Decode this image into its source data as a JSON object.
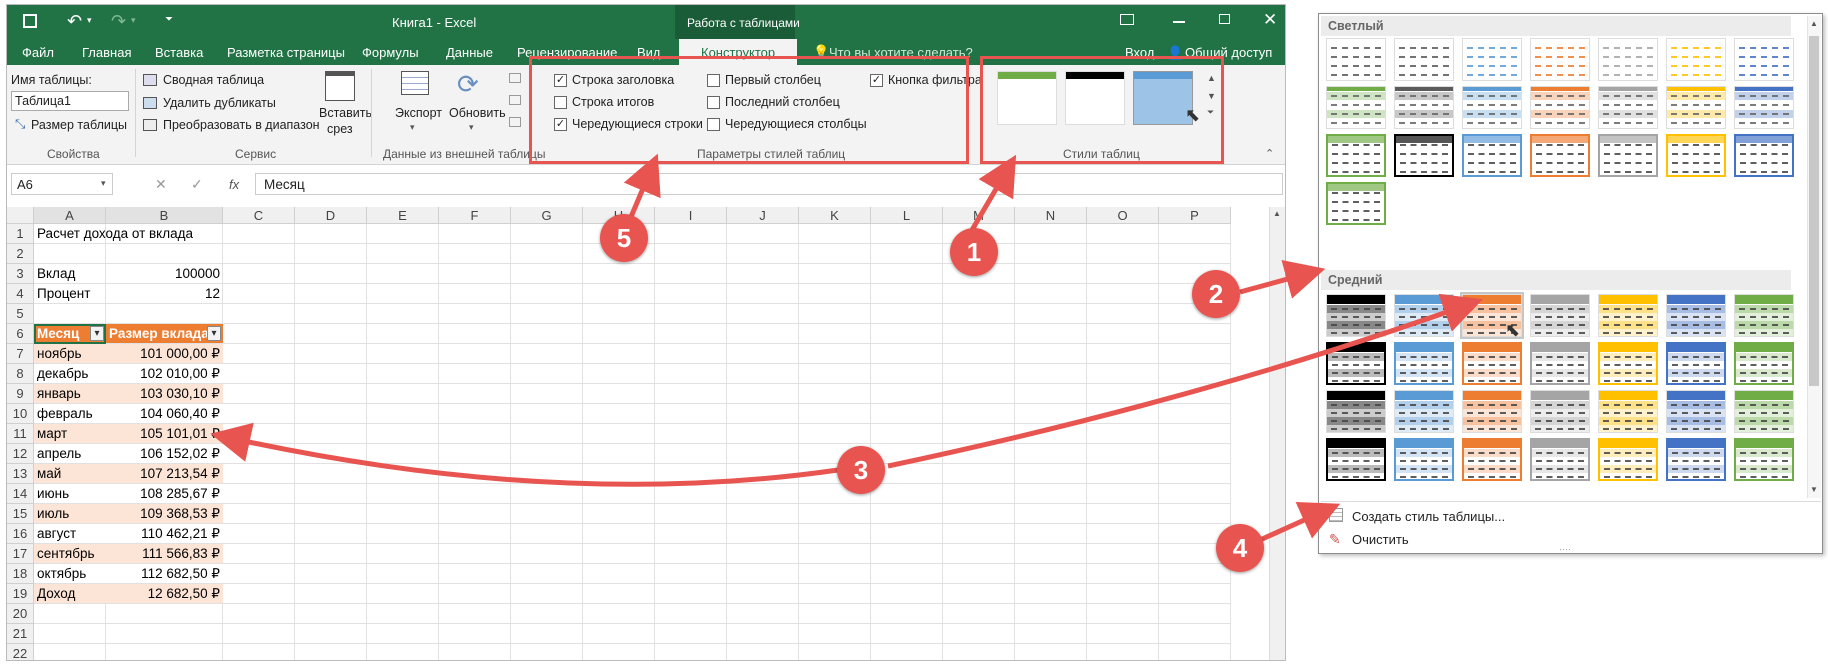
{
  "title": {
    "document": "Книга1 - Excel",
    "context_tab": "Работа с таблицами",
    "quick_access": {
      "save": "save-icon",
      "undo": "undo-icon",
      "redo": "redo-icon",
      "customize": "customize-icon"
    },
    "window_controls": [
      "ribbon-display-icon",
      "minimize-icon",
      "restore-icon",
      "close-icon"
    ]
  },
  "tabs": [
    "Файл",
    "Главная",
    "Вставка",
    "Разметка страницы",
    "Формулы",
    "Данные",
    "Рецензирование",
    "Вид",
    "Конструктор"
  ],
  "tell_me": "Что вы хотите сделать?",
  "signin": "Вход",
  "share": "Общий доступ",
  "ribbon": {
    "props": {
      "name_label": "Имя таблицы:",
      "name_value": "Таблица1",
      "resize": "Размер таблицы",
      "group": "Свойства"
    },
    "tools": {
      "pivot": "Сводная таблица",
      "dedupe": "Удалить дубликаты",
      "convert": "Преобразовать в диапазон",
      "slicer_1": "Вставить",
      "slicer_2": "срез",
      "group": "Сервис"
    },
    "external": {
      "export": "Экспорт",
      "refresh": "Обновить",
      "group": "Данные из внешней таблицы"
    },
    "options": {
      "header_row": "Строка заголовка",
      "total_row": "Строка итогов",
      "banded_rows": "Чередующиеся строки",
      "first_col": "Первый столбец",
      "last_col": "Последний столбец",
      "banded_cols": "Чередующиеся столбцы",
      "filter_btn": "Кнопка фильтра",
      "group": "Параметры стилей таблиц"
    },
    "styles_group": "Стили таблиц"
  },
  "formula_bar": {
    "name_box": "A6",
    "fx": "fx",
    "content": "Месяц"
  },
  "columns": [
    "A",
    "B",
    "C",
    "D",
    "E",
    "F",
    "G",
    "H",
    "I",
    "J",
    "K",
    "L",
    "M",
    "N",
    "O",
    "P"
  ],
  "rows": [
    "1",
    "2",
    "3",
    "4",
    "5",
    "6",
    "7",
    "8",
    "9",
    "10",
    "11",
    "12",
    "13",
    "14",
    "15",
    "16",
    "17",
    "18",
    "19",
    "20",
    "21",
    "22"
  ],
  "cells": {
    "a1": "Расчет дохода от вклада",
    "a3": "Вклад",
    "b3": "100000",
    "a4": "Процент",
    "b4": "12",
    "table_header": [
      "Месяц",
      "Размер вклада"
    ],
    "table_rows": [
      [
        "ноябрь",
        "101 000,00 ₽"
      ],
      [
        "декабрь",
        "102 010,00 ₽"
      ],
      [
        "январь",
        "103 030,10 ₽"
      ],
      [
        "февраль",
        "104 060,40 ₽"
      ],
      [
        "март",
        "105 101,01 ₽"
      ],
      [
        "апрель",
        "106 152,02 ₽"
      ],
      [
        "май",
        "107 213,54 ₽"
      ],
      [
        "июнь",
        "108 285,67 ₽"
      ],
      [
        "июль",
        "109 368,53 ₽"
      ],
      [
        "август",
        "110 462,21 ₽"
      ],
      [
        "сентябрь",
        "111 566,83 ₽"
      ],
      [
        "октябрь",
        "112 682,50 ₽"
      ],
      [
        "Доход",
        "12 682,50 ₽"
      ]
    ]
  },
  "gallery": {
    "light_title": "Светлый",
    "medium_title": "Средний",
    "create_style": "Создать стиль таблицы...",
    "clear": "Очистить",
    "palette": [
      "#8c8c8c",
      "#5b5b5b",
      "#5b9bd5",
      "#ed7d31",
      "#a5a5a5",
      "#ffc000",
      "#4472c4",
      "#70ad47",
      "#000000"
    ]
  },
  "callouts": [
    "1",
    "2",
    "3",
    "4",
    "5"
  ],
  "colors": {
    "excel_green": "#217346",
    "table_header": "#ed7d31",
    "band": "#fce4d6",
    "callout": "#e85450"
  }
}
